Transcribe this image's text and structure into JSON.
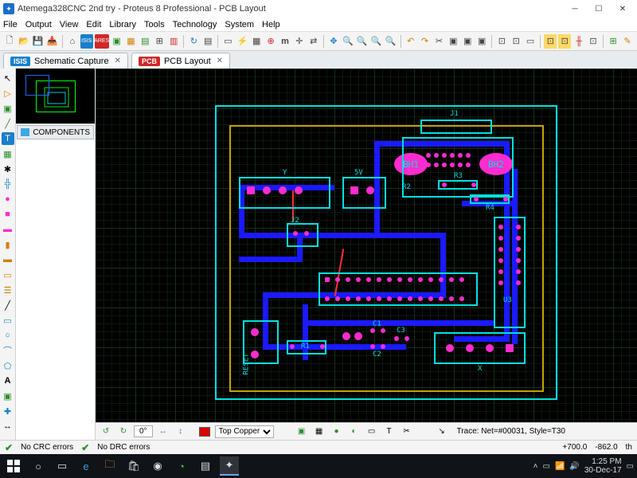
{
  "window": {
    "title": "Atemega328CNC 2nd try - Proteus 8 Professional - PCB Layout"
  },
  "menu": [
    "File",
    "Output",
    "View",
    "Edit",
    "Library",
    "Tools",
    "Technology",
    "System",
    "Help"
  ],
  "tabs": [
    {
      "badge": "ISIS",
      "badge_color": "#1a7fc9",
      "label": "Schematic Capture",
      "active": false
    },
    {
      "badge": "PCB",
      "badge_color": "#d02727",
      "label": "PCB Layout",
      "active": true
    }
  ],
  "components_header": "COMPONENTS",
  "layer_selector": "Top Copper",
  "trace_info": "Trace: Net=#00031, Style=T30",
  "status": {
    "crc": "No CRC errors",
    "drc": "No DRC errors",
    "x": "+700.0",
    "y": "-862.0",
    "unit": "th"
  },
  "pcb_labels": {
    "bh1": "BH1",
    "bh2": "BH2",
    "j1": "J1",
    "j2": "J2",
    "r2": "R2",
    "r3": "R3",
    "r4": "R4",
    "r1": "R1",
    "u3": "U3",
    "c1": "C1",
    "c2": "C2",
    "c3": "C3",
    "reset": "RESET",
    "x_conn": "X",
    "y_conn": "Y",
    "five_v": "5V"
  },
  "rotation_display": "0°",
  "taskbar": {
    "time": "1:25 PM",
    "date": "30-Dec-17"
  }
}
